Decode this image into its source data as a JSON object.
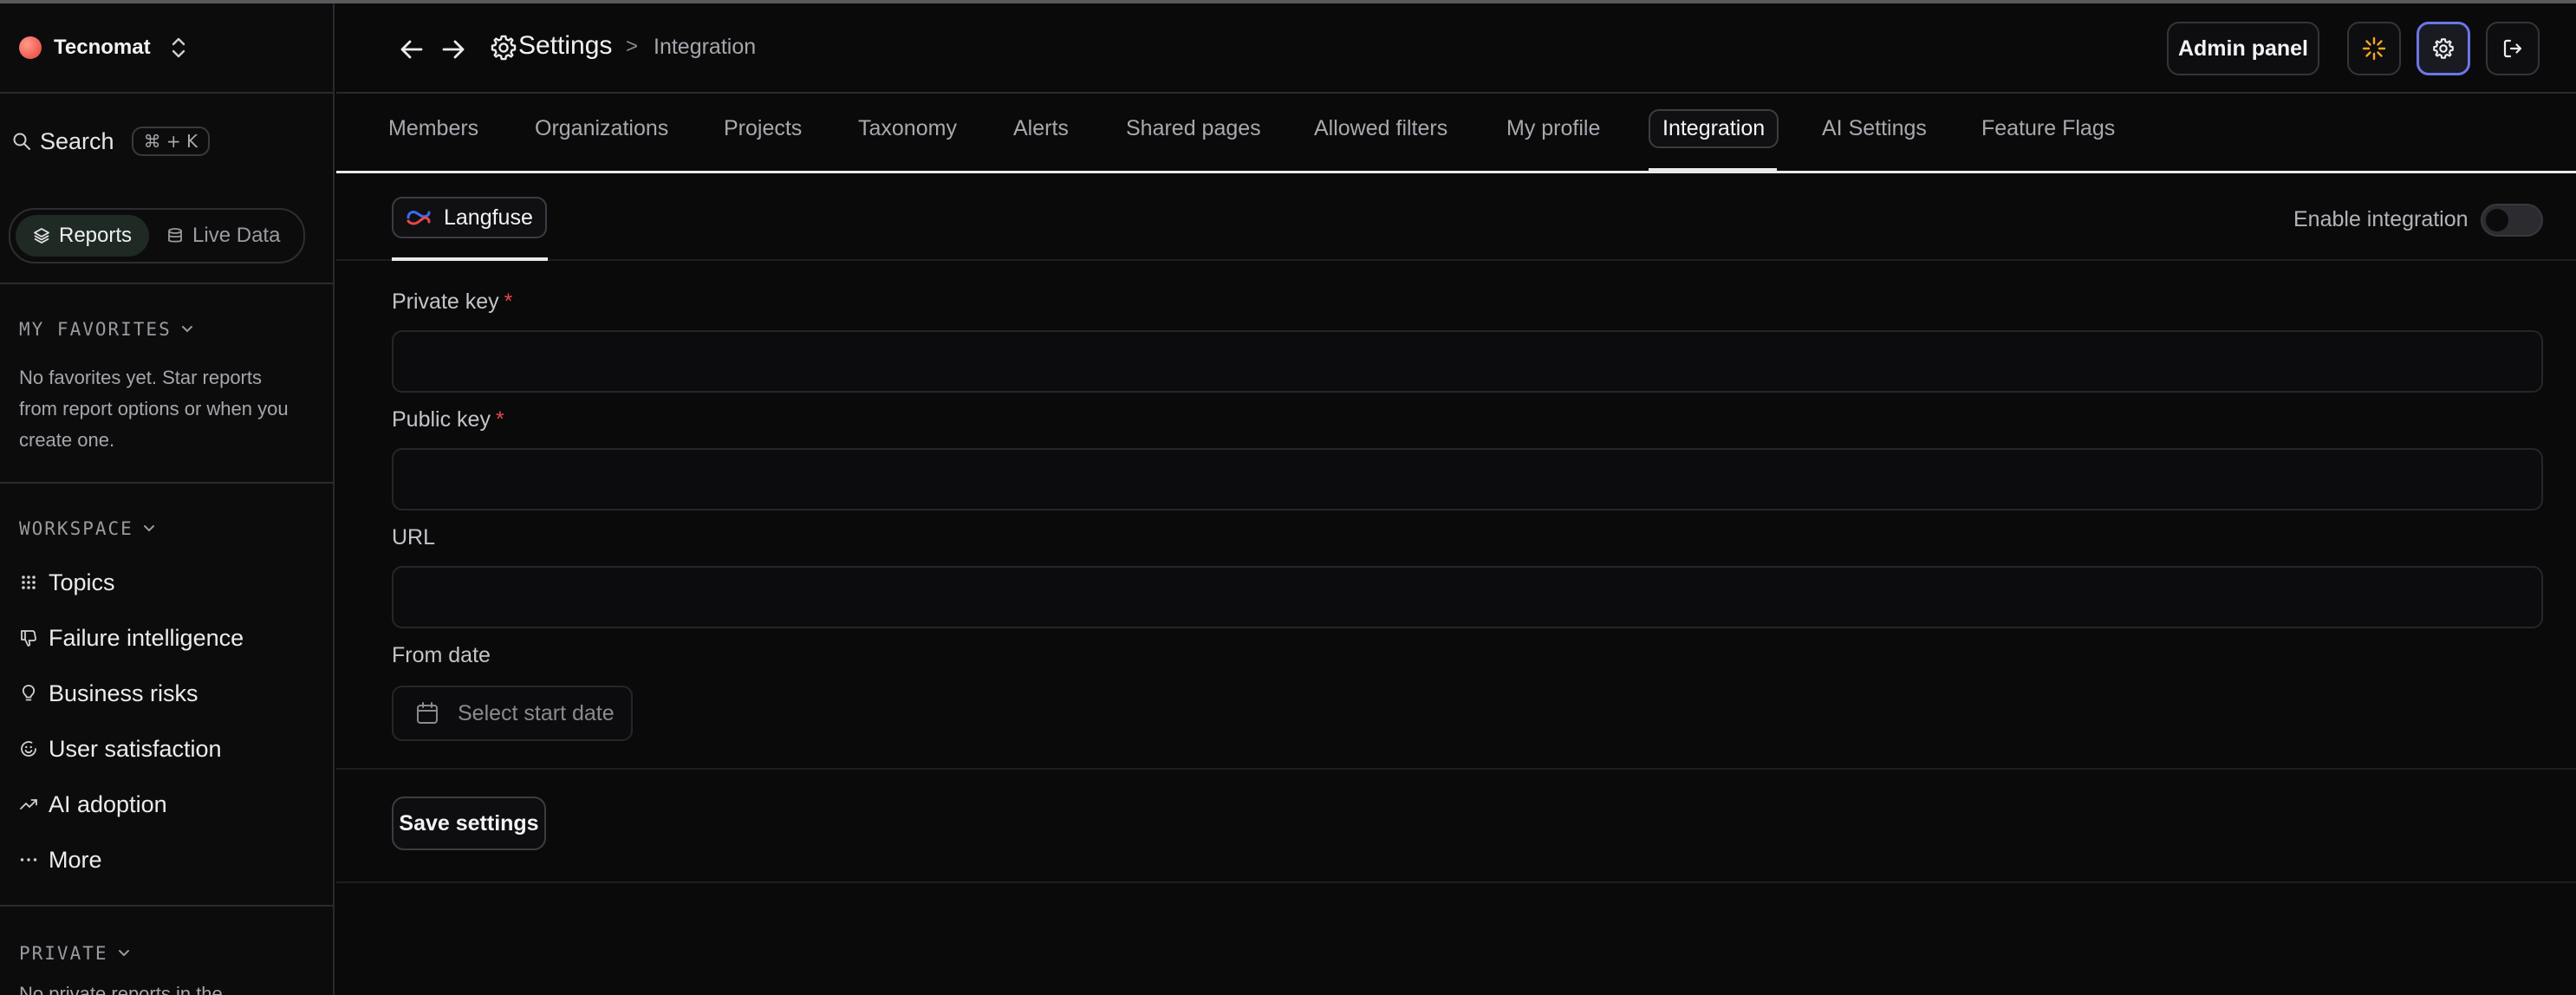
{
  "workspace": {
    "name": "Tecnomat"
  },
  "search": {
    "label": "Search",
    "shortcut": "⌘ + K"
  },
  "view_switch": {
    "reports": "Reports",
    "live_data": "Live Data"
  },
  "favorites": {
    "heading": "MY FAVORITES",
    "empty_text": "No favorites yet. Star reports from report options or when you create one."
  },
  "workspace_section": {
    "heading": "WORKSPACE",
    "items": [
      {
        "label": "Topics",
        "icon": "grid-icon"
      },
      {
        "label": "Failure intelligence",
        "icon": "thumbs-down-icon"
      },
      {
        "label": "Business risks",
        "icon": "lightbulb-icon"
      },
      {
        "label": "User satisfaction",
        "icon": "smile-icon"
      },
      {
        "label": "AI adoption",
        "icon": "trending-up-icon"
      },
      {
        "label": "More",
        "icon": "ellipsis-icon"
      }
    ]
  },
  "private_section": {
    "heading": "PRIVATE",
    "empty_text": "No private reports in the"
  },
  "header": {
    "breadcrumb_root": "Settings",
    "breadcrumb_sep": ">",
    "breadcrumb_current": "Integration",
    "admin_panel": "Admin panel"
  },
  "tabs": [
    {
      "label": "Members"
    },
    {
      "label": "Organizations"
    },
    {
      "label": "Projects"
    },
    {
      "label": "Taxonomy"
    },
    {
      "label": "Alerts"
    },
    {
      "label": "Shared pages"
    },
    {
      "label": "Allowed filters"
    },
    {
      "label": "My profile"
    },
    {
      "label": "Integration",
      "active": true
    },
    {
      "label": "AI Settings"
    },
    {
      "label": "Feature Flags"
    }
  ],
  "integration": {
    "provider": "Langfuse",
    "enable_label": "Enable integration",
    "enabled": false,
    "fields": {
      "private_key": {
        "label": "Private key",
        "required_mark": "*",
        "value": ""
      },
      "public_key": {
        "label": "Public key",
        "required_mark": "*",
        "value": ""
      },
      "url": {
        "label": "URL",
        "value": ""
      },
      "from_date": {
        "label": "From date",
        "placeholder": "Select start date"
      }
    },
    "save_label": "Save settings"
  },
  "colors": {
    "background": "#0a0a0b",
    "required": "#e5484d",
    "accent_active": "#6b76e8",
    "theme_icon": "#f5a524",
    "workspace_dot": "#f05a4f"
  }
}
